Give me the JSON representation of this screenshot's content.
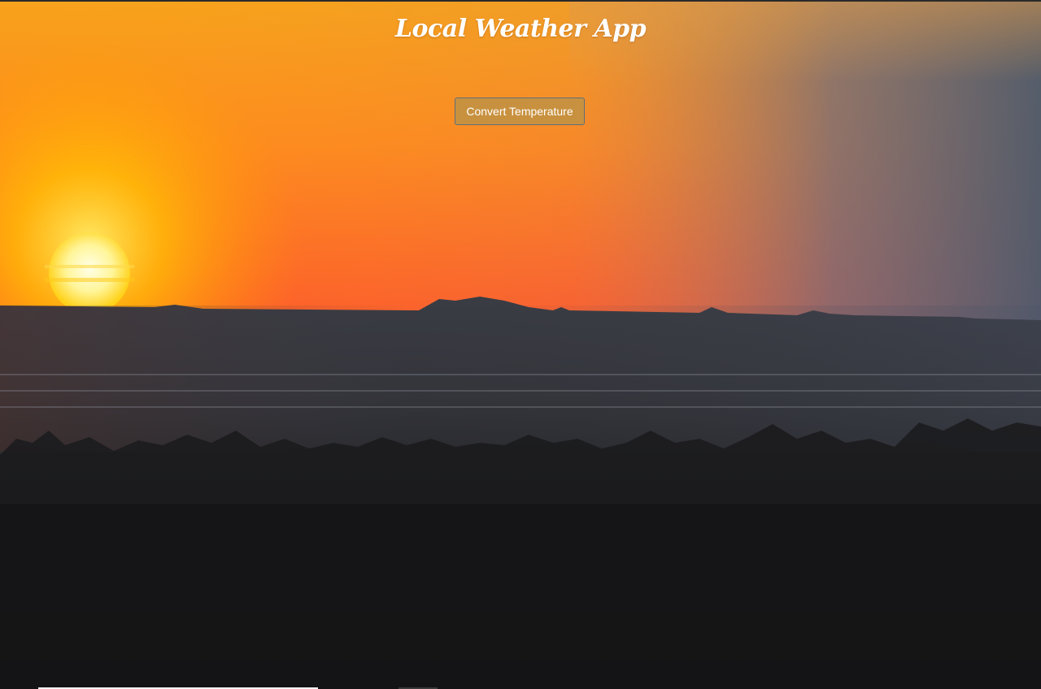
{
  "app": {
    "title": "Local Weather App"
  },
  "controls": {
    "convert_label": "Convert Temperature"
  },
  "background": {
    "scene": "desert-sunset-photo",
    "colors": {
      "sky_top": "#f0a030",
      "sky_horizon": "#ff5f2a",
      "sky_right": "#5a6478",
      "sun": "#ffd21a",
      "land": "#2b2b30",
      "foreground": "#141416"
    }
  },
  "colors": {
    "button_bg": "#c8913f",
    "button_border": "#5e6f7a",
    "title_text": "#ffffff"
  }
}
